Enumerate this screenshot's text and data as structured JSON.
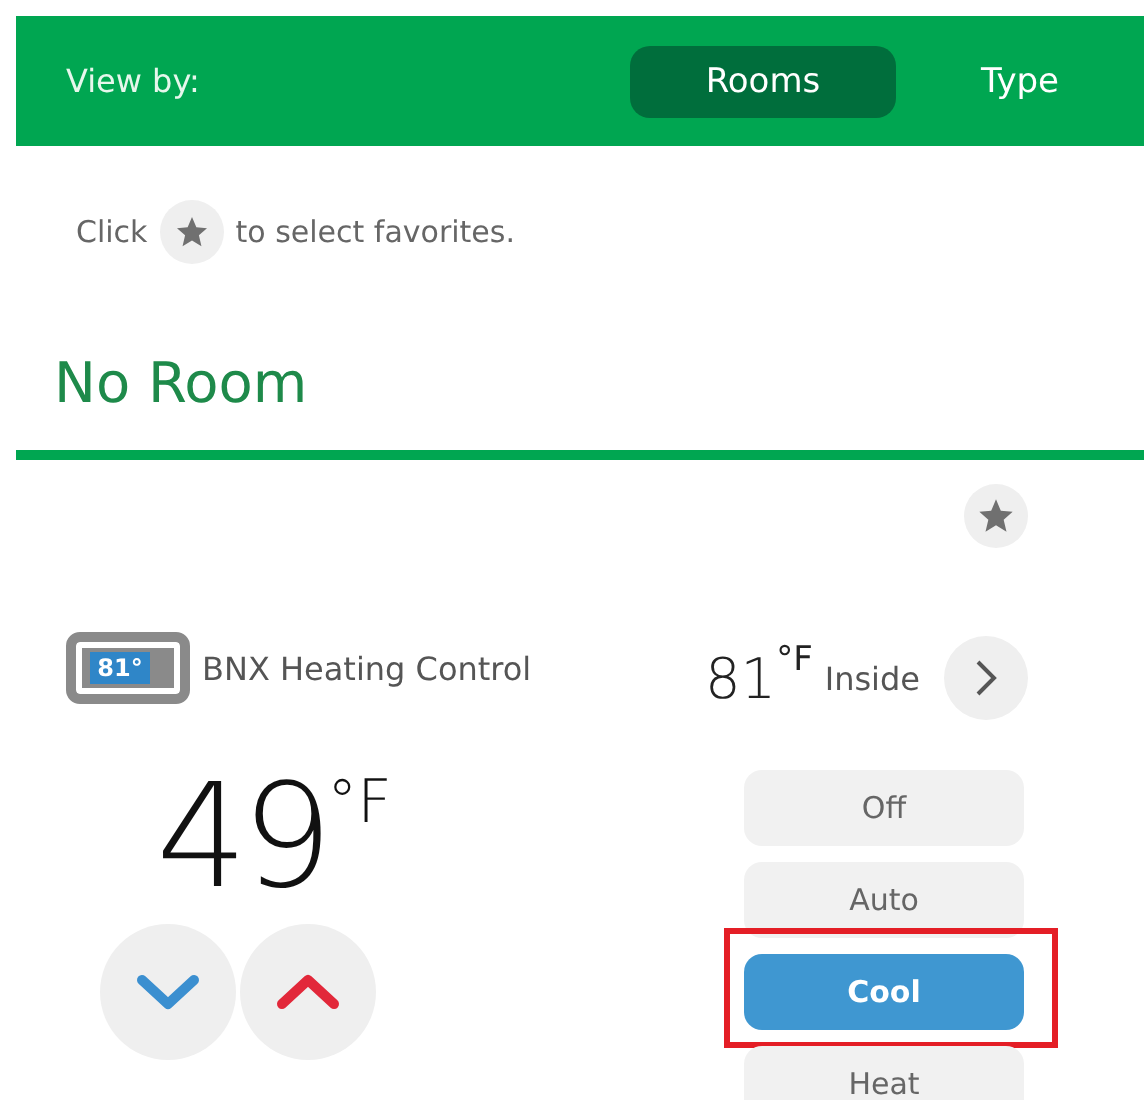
{
  "header": {
    "label": "View by:",
    "options": [
      {
        "label": "Rooms",
        "selected": true
      },
      {
        "label": "Type",
        "selected": false
      }
    ]
  },
  "hint": {
    "before": "Click",
    "after": "to select favorites."
  },
  "room": {
    "title": "No Room"
  },
  "device": {
    "name": "BNX Heating Control",
    "icon_reading": "81°",
    "setpoint": "49",
    "setpoint_unit": "°F",
    "inside_temp": "81",
    "inside_unit": "°F",
    "inside_label": "Inside",
    "modes": [
      {
        "label": "Off",
        "selected": false,
        "highlighted": false
      },
      {
        "label": "Auto",
        "selected": false,
        "highlighted": false
      },
      {
        "label": "Cool",
        "selected": true,
        "highlighted": true
      },
      {
        "label": "Heat",
        "selected": false,
        "highlighted": false
      }
    ]
  }
}
